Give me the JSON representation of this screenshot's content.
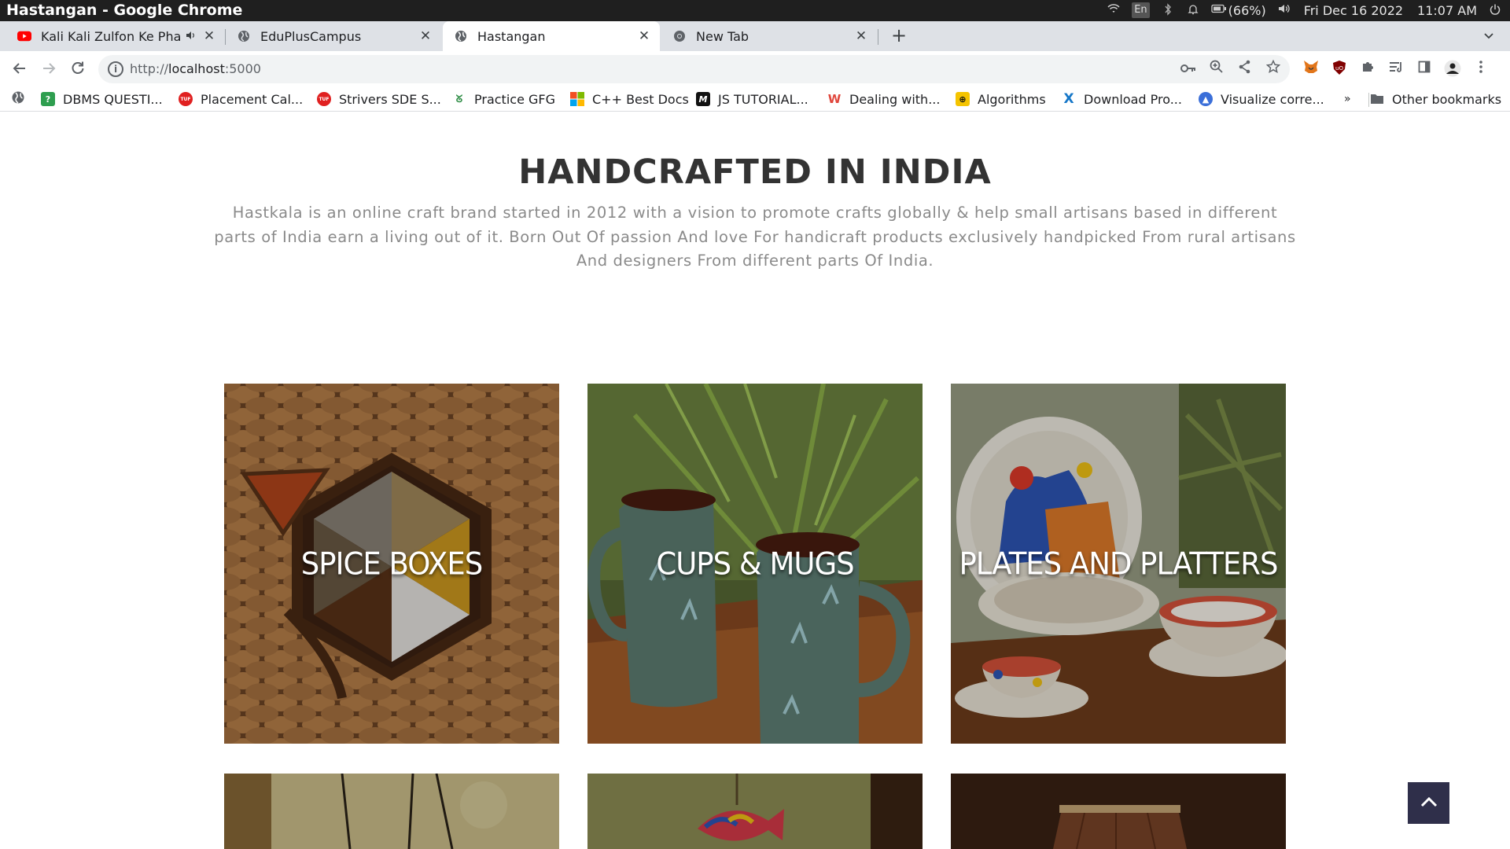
{
  "os": {
    "window_title": "Hastangan - Google Chrome",
    "lang": "En",
    "battery": "(66%)",
    "date": "Fri Dec 16 2022",
    "time": "11:07 AM"
  },
  "tabs": [
    {
      "label": "Kali Kali Zulfon Ke Pha",
      "favicon": "youtube-icon",
      "audio": true
    },
    {
      "label": "EduPlusCampus",
      "favicon": "globe-icon"
    },
    {
      "label": "Hastangan",
      "favicon": "globe-icon",
      "active": true
    },
    {
      "label": "New Tab",
      "favicon": "chrome-icon"
    }
  ],
  "toolbar": {
    "url_prefix": "http://",
    "url_host": "localhost",
    "url_port": ":5000"
  },
  "bookmarks": [
    {
      "label": "DBMS QUESTI...",
      "icon": "question-icon",
      "color": "#2e9e4f"
    },
    {
      "label": "Placement Cal...",
      "icon": "tuf-icon",
      "color": "#e02020"
    },
    {
      "label": "Strivers SDE S...",
      "icon": "tuf-icon",
      "color": "#e02020"
    },
    {
      "label": "Practice GFG",
      "icon": "gfg-icon",
      "color": "#2f8d46"
    },
    {
      "label": "C++ Best Docs",
      "icon": "microsoft-icon",
      "color": "#f25022"
    },
    {
      "label": "JS TUTORIAL...",
      "icon": "m-icon",
      "color": "#111111"
    },
    {
      "label": "Dealing with...",
      "icon": "leetcode-w-icon",
      "color": "#e0463c"
    },
    {
      "label": "Algorithms",
      "icon": "algo-icon",
      "color": "#f5c400"
    },
    {
      "label": "Download Pro...",
      "icon": "x-icon",
      "color": "#1677c8"
    },
    {
      "label": "Visualize corre...",
      "icon": "visualize-icon",
      "color": "#3b6fd9"
    },
    {
      "label": "Other bookmarks",
      "icon": "folder-icon",
      "color": "#5f6368"
    }
  ],
  "bookmarks_overflow": "»",
  "page": {
    "title": "HANDCRAFTED IN INDIA",
    "description": "Hastkala is an online craft brand started in 2012 with a vision to promote crafts globally & help small artisans based in different parts of India earn a living out of it. Born Out Of passion And love For handicraft products exclusively handpicked From rural artisans And designers From different parts Of India."
  },
  "categories": [
    {
      "label": "SPICE BOXES"
    },
    {
      "label": "CUPS & MUGS"
    },
    {
      "label": "PLATES AND PLATTERS"
    },
    {
      "label": ""
    },
    {
      "label": ""
    },
    {
      "label": ""
    }
  ],
  "colors": {
    "accent_dark": "#2f2f4a",
    "title": "#333333",
    "description": "#8a8a8a"
  }
}
